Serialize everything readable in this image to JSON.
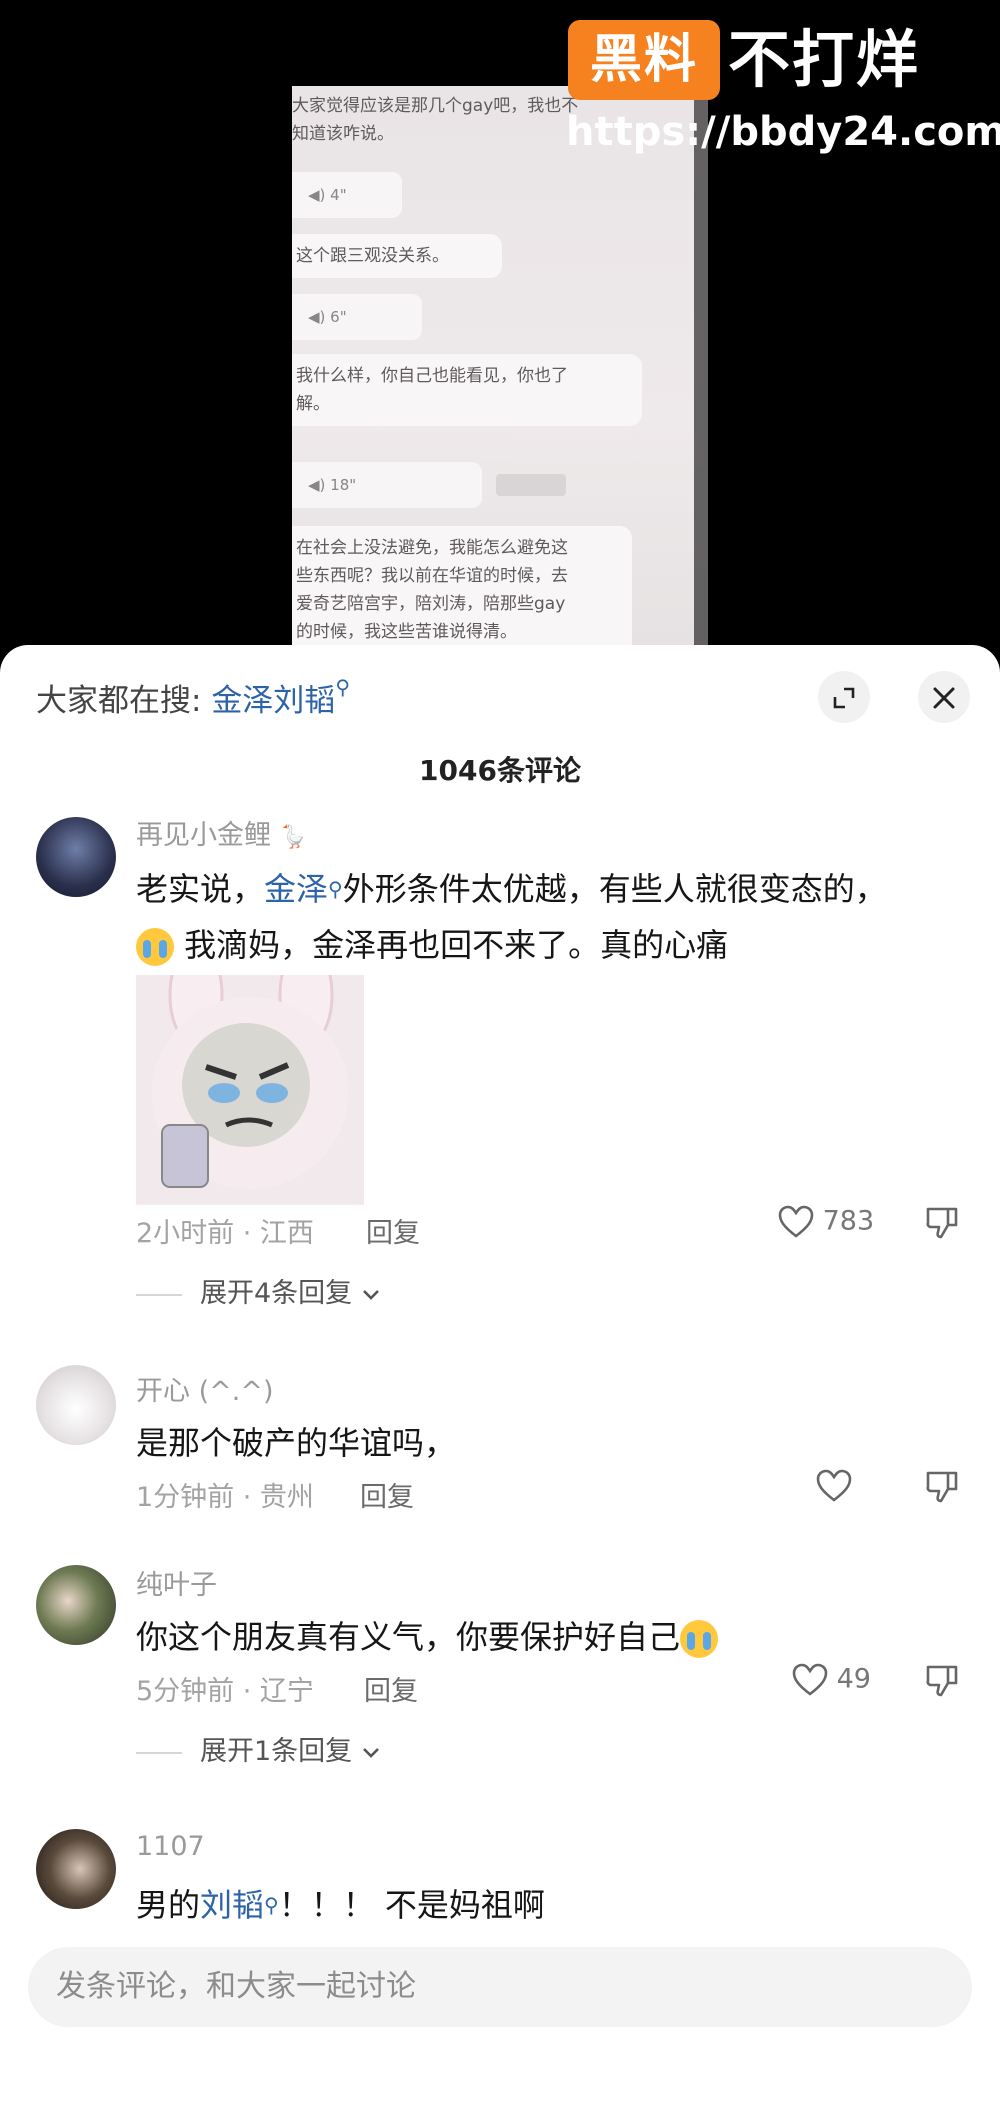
{
  "watermark": {
    "brand_box": "黑料",
    "brand_title": "不打烊",
    "url": "https://bbdy24.com"
  },
  "video_chat": {
    "lines": [
      {
        "text": "大家觉得应该是那几个gay吧，我也不\n知道该咋说。"
      },
      {
        "duration": "4\""
      },
      {
        "text": "这个跟三观没关系。"
      },
      {
        "duration": "6\""
      },
      {
        "text": "我什么样，你自己也能看见，你也了\n解。"
      },
      {
        "duration": "18\""
      },
      {
        "text": "在社会上没法避免，我能怎么避免这\n些东西呢？我以前在华谊的时候，去\n爱奇艺陪宫宇，陪刘涛，陪那些gay\n的时候，我这些苦谁说得清。"
      }
    ]
  },
  "header": {
    "search_prefix": "大家都在搜: ",
    "search_keyword": "金泽刘韬",
    "comment_count": "1046条评论"
  },
  "comments": [
    {
      "username": "再见小金鲤",
      "text_before": "老实说，",
      "keyword": "金泽",
      "text_after": "外形条件太优越，有些人就很变态的，",
      "text_line2": "我滴妈，金泽再也回不来了。真的心痛",
      "meta": "2小时前 · 江西",
      "reply_label": "回复",
      "likes": "783",
      "expand_label": "展开4条回复"
    },
    {
      "username": "开心 (^.^)",
      "text": "是那个破产的华谊吗，",
      "meta": "1分钟前 · 贵州",
      "reply_label": "回复",
      "likes": ""
    },
    {
      "username": "纯叶子",
      "text": "你这个朋友真有义气，你要保护好自己",
      "meta": "5分钟前 · 辽宁",
      "reply_label": "回复",
      "likes": "49",
      "expand_label": "展开1条回复"
    },
    {
      "username": "1107",
      "text_before": "男的",
      "keyword": "刘韬",
      "text_after": "！！！ 不是妈祖啊"
    }
  ],
  "input": {
    "placeholder": "发条评论，和大家一起讨论"
  },
  "icons": [
    "expand-icon",
    "close-icon",
    "search-icon",
    "heart-icon",
    "dislike-icon",
    "chevron-down-icon",
    "crying-emoji-icon"
  ],
  "colors": {
    "keyword": "#2d63a8",
    "brand_orange": "#f5821f",
    "sheet_bg": "#ffffff"
  }
}
